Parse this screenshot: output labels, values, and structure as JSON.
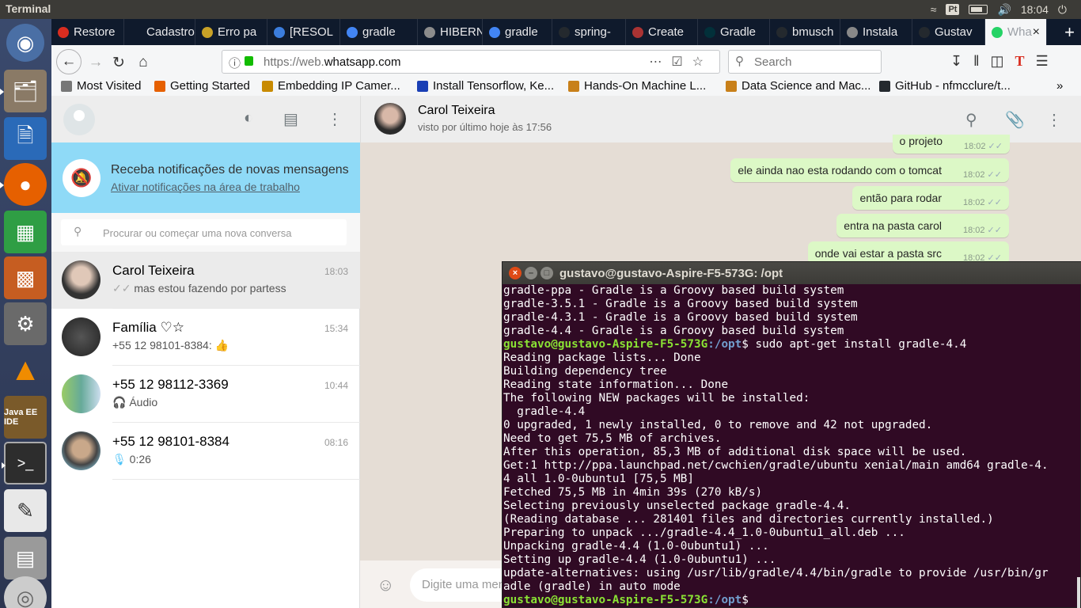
{
  "topbar": {
    "title": "Terminal",
    "keyboard": "Pt",
    "clock": "18:04"
  },
  "launcher": {
    "items": [
      "ubuntu-dash",
      "files",
      "writer",
      "firefox",
      "calc",
      "impress",
      "system-settings",
      "vlc",
      "java-ee-ide",
      "terminal",
      "text-editor",
      "disks",
      "dvd"
    ]
  },
  "browser": {
    "tabs": [
      {
        "label": "Restore",
        "color": "#d92d20"
      },
      {
        "label": "Cadastro",
        "color": ""
      },
      {
        "label": "Erro pa",
        "color": "#c9a227"
      },
      {
        "label": "[RESOL",
        "color": "#3b7ddd"
      },
      {
        "label": "gradle",
        "color": "#4285f4"
      },
      {
        "label": "HIBERN",
        "color": "#8c8c8c"
      },
      {
        "label": "gradle",
        "color": "#4285f4"
      },
      {
        "label": "spring-",
        "color": "#24292e"
      },
      {
        "label": "Create",
        "color": "#a33"
      },
      {
        "label": "Gradle",
        "color": "#02303a"
      },
      {
        "label": "bmusch",
        "color": "#24292e"
      },
      {
        "label": "Instala",
        "color": "#888"
      },
      {
        "label": "Gustav",
        "color": "#24292e"
      },
      {
        "label": "Wha",
        "color": "#25d366"
      }
    ],
    "url": {
      "prefix": "https://web.",
      "domain": "whatsapp.com"
    },
    "search_placeholder": "Search",
    "bookmarks": [
      "Most Visited",
      "Getting Started",
      "Embedding IP Camer...",
      "Install Tensorflow, Ke...",
      "Hands-On Machine L...",
      "Data Science and Mac...",
      "GitHub - nfmcclure/t..."
    ]
  },
  "whatsapp": {
    "notification": {
      "title": "Receba notificações de novas mensagens",
      "link": "Ativar notificações na área de trabalho"
    },
    "search_placeholder": "Procurar ou começar uma nova conversa",
    "chats": [
      {
        "name": "Carol Teixeira",
        "time": "18:03",
        "message": "mas estou fazendo por partess"
      },
      {
        "name": "Família ♡☆",
        "time": "15:34",
        "message": "+55 12 98101-8384: 👍"
      },
      {
        "name": "+55 12 98112-3369",
        "time": "10:44",
        "message": "Áudio"
      },
      {
        "name": "+55 12 98101-8384",
        "time": "08:16",
        "message": "0:26"
      }
    ],
    "conversation": {
      "name": "Carol Teixeira",
      "status": "visto por último hoje às 17:56",
      "messages": [
        {
          "text": "o projeto",
          "time": "18:02"
        },
        {
          "text": "ele ainda nao esta rodando com o tomcat",
          "time": "18:02"
        },
        {
          "text": "então para rodar",
          "time": "18:02"
        },
        {
          "text": "entra na pasta carol",
          "time": "18:02"
        },
        {
          "text": "onde vai estar a pasta src",
          "time": "18:02"
        }
      ],
      "composer_placeholder": "Digite uma mensagem"
    }
  },
  "terminal": {
    "title": "gustavo@gustavo-Aspire-F5-573G: /opt",
    "prompt_user": "gustavo@gustavo-Aspire-F5-573G",
    "prompt_path": ":/opt",
    "lines_before": [
      "gradle-ppa - Gradle is a Groovy based build system",
      "gradle-3.5.1 - Gradle is a Groovy based build system",
      "gradle-4.3.1 - Gradle is a Groovy based build system",
      "gradle-4.4 - Gradle is a Groovy based build system"
    ],
    "command": "$ sudo apt-get install gradle-4.4",
    "output": [
      "Reading package lists... Done",
      "Building dependency tree",
      "Reading state information... Done",
      "The following NEW packages will be installed:",
      "  gradle-4.4",
      "0 upgraded, 1 newly installed, 0 to remove and 42 not upgraded.",
      "Need to get 75,5 MB of archives.",
      "After this operation, 85,3 MB of additional disk space will be used.",
      "Get:1 http://ppa.launchpad.net/cwchien/gradle/ubuntu xenial/main amd64 gradle-4.",
      "4 all 1.0-0ubuntu1 [75,5 MB]",
      "Fetched 75,5 MB in 4min 39s (270 kB/s)",
      "Selecting previously unselected package gradle-4.4.",
      "(Reading database ... 281401 files and directories currently installed.)",
      "Preparing to unpack .../gradle-4.4_1.0-0ubuntu1_all.deb ...",
      "Unpacking gradle-4.4 (1.0-0ubuntu1) ...",
      "Setting up gradle-4.4 (1.0-0ubuntu1) ...",
      "update-alternatives: using /usr/lib/gradle/4.4/bin/gradle to provide /usr/bin/gr",
      "adle (gradle) in auto mode"
    ],
    "final_prompt_suffix": "$"
  }
}
